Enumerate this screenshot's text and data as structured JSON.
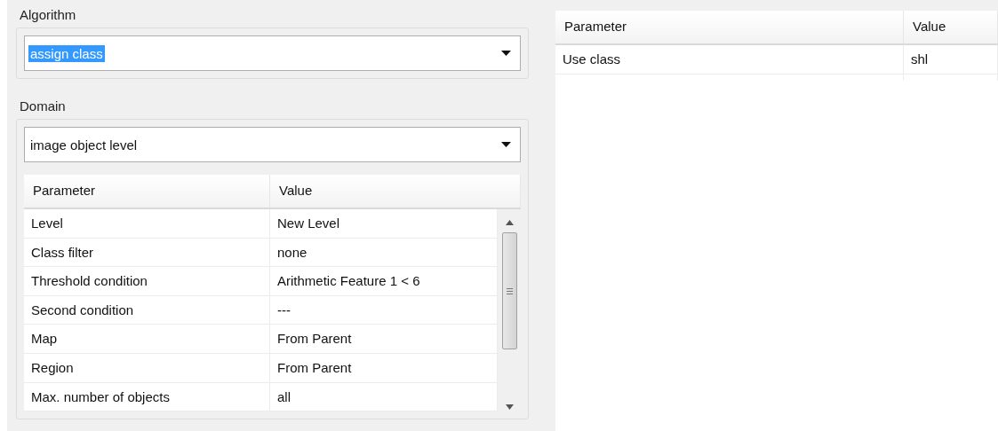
{
  "algorithm": {
    "label": "Algorithm",
    "value": "assign class",
    "value_selected": true
  },
  "domain": {
    "label": "Domain",
    "value": "image object level",
    "value_selected": false,
    "table": {
      "columns": [
        "Parameter",
        "Value"
      ],
      "rows": [
        {
          "parameter": "Level",
          "value": "New Level"
        },
        {
          "parameter": "Class filter",
          "value": "none"
        },
        {
          "parameter": "Threshold condition",
          "value": "Arithmetic Feature 1 < 6"
        },
        {
          "parameter": "Second condition",
          "value": "---"
        },
        {
          "parameter": "Map",
          "value": "From Parent"
        },
        {
          "parameter": "Region",
          "value": "From Parent"
        },
        {
          "parameter": "Max. number of objects",
          "value": "all"
        }
      ]
    }
  },
  "algorithm_parameters": {
    "columns": [
      "Parameter",
      "Value"
    ],
    "rows": [
      {
        "parameter": "Use class",
        "value": "shl"
      }
    ]
  }
}
